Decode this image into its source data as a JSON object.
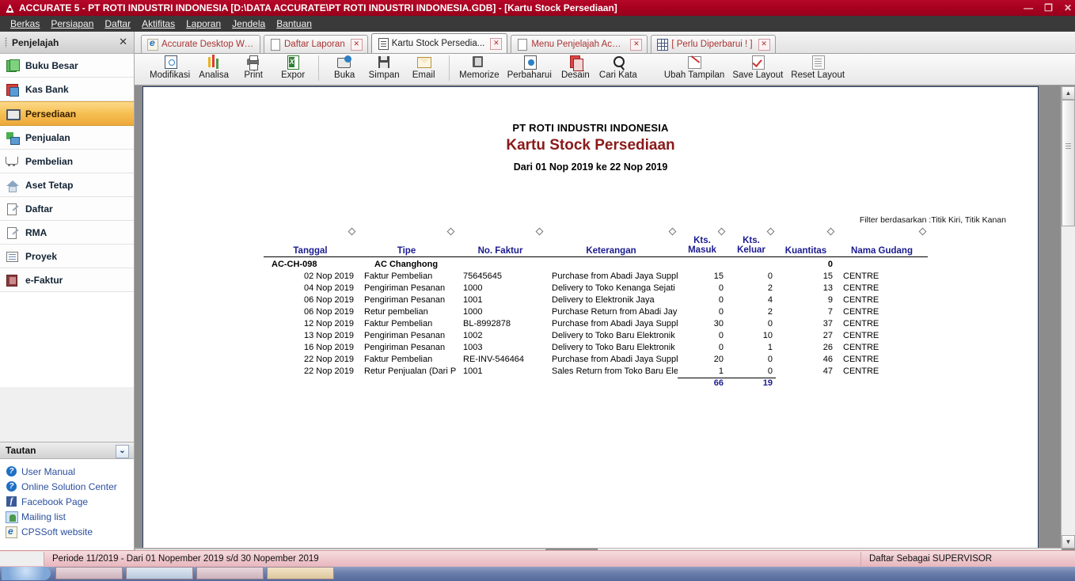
{
  "window": {
    "title": "ACCURATE 5  - PT ROTI INDUSTRI INDONESIA   [D:\\DATA ACCURATE\\PT ROTI INDUSTRI INDONESIA.GDB] - [Kartu Stock Persediaan]",
    "minimize": "—",
    "maximize": "❐",
    "close": "✕",
    "logo": "A"
  },
  "menu": {
    "items": [
      "Berkas",
      "Persiapan",
      "Daftar",
      "Aktifitas",
      "Laporan",
      "Jendela",
      "Bantuan"
    ]
  },
  "sidebar": {
    "header": "Penjelajah",
    "close": "✕",
    "items": [
      {
        "label": "Buku Besar",
        "icon": "ledger-icon"
      },
      {
        "label": "Kas Bank",
        "icon": "bank-icon"
      },
      {
        "label": "Persediaan",
        "icon": "inventory-icon"
      },
      {
        "label": "Penjualan",
        "icon": "sales-icon"
      },
      {
        "label": "Pembelian",
        "icon": "purchase-cart-icon"
      },
      {
        "label": "Aset Tetap",
        "icon": "fixed-asset-icon"
      },
      {
        "label": "Daftar",
        "icon": "list-icon"
      },
      {
        "label": "RMA",
        "icon": "rma-icon"
      },
      {
        "label": "Proyek",
        "icon": "project-icon"
      },
      {
        "label": "e-Faktur",
        "icon": "efaktur-icon"
      }
    ],
    "selected": "Persediaan",
    "links_header": "Tautan",
    "links_chevron": "⌄",
    "links": [
      {
        "label": "User Manual",
        "icon": "help-icon"
      },
      {
        "label": "Online Solution Center",
        "icon": "help-icon"
      },
      {
        "label": "Facebook Page",
        "icon": "facebook-icon"
      },
      {
        "label": "Mailing list",
        "icon": "mail-list-icon"
      },
      {
        "label": "CPSSoft website",
        "icon": "browser-icon"
      }
    ]
  },
  "tabs": [
    {
      "label": "Accurate Desktop Wel...",
      "icon": "browser-icon",
      "active": false,
      "closable": false
    },
    {
      "label": "Daftar Laporan",
      "icon": "document-icon",
      "active": false,
      "closable": true,
      "close": "✕"
    },
    {
      "label": "Kartu Stock Persedia...",
      "icon": "report-icon",
      "active": true,
      "closable": true,
      "close": "✕"
    },
    {
      "label": "Menu Penjelajah Accu...",
      "icon": "document-icon",
      "active": false,
      "closable": true,
      "close": "✕"
    },
    {
      "label": "[ Perlu Diperbarui ! ]",
      "icon": "table-icon",
      "active": false,
      "closable": true,
      "close": "✕"
    }
  ],
  "toolbar": {
    "groups": [
      [
        {
          "label": "Modifikasi",
          "icon": "modify-icon"
        },
        {
          "label": "Analisa",
          "icon": "chart-icon"
        },
        {
          "label": "Print",
          "icon": "printer-icon"
        },
        {
          "label": "Expor",
          "icon": "excel-export-icon"
        }
      ],
      [
        {
          "label": "Buka",
          "icon": "open-folder-icon"
        },
        {
          "label": "Simpan",
          "icon": "save-disk-icon"
        },
        {
          "label": "Email",
          "icon": "envelope-icon"
        }
      ],
      [
        {
          "label": "Memorize",
          "icon": "memorize-icon"
        },
        {
          "label": "Perbaharui",
          "icon": "refresh-icon"
        },
        {
          "label": "Desain",
          "icon": "design-icon"
        },
        {
          "label": "Cari Kata",
          "icon": "search-icon"
        }
      ],
      [
        {
          "label": "Ubah Tampilan",
          "icon": "edit-view-icon"
        },
        {
          "label": "Save Layout",
          "icon": "save-layout-icon"
        },
        {
          "label": "Reset Layout",
          "icon": "reset-layout-icon"
        }
      ]
    ]
  },
  "report": {
    "company": "PT ROTI INDUSTRI INDONESIA",
    "title": "Kartu Stock Persediaan",
    "date_range": "Dari 01 Nop 2019 ke 22 Nop 2019",
    "filter_note": "Filter berdasarkan :Titik Kiri, Titik Kanan",
    "columns": [
      {
        "label": "Tanggal",
        "line2": ""
      },
      {
        "label": "Tipe",
        "line2": ""
      },
      {
        "label": "No. Faktur",
        "line2": ""
      },
      {
        "label": "Keterangan",
        "line2": ""
      },
      {
        "label": "Kts.",
        "line2": "Masuk"
      },
      {
        "label": "Kts.",
        "line2": "Keluar"
      },
      {
        "label": "Kuantitas",
        "line2": ""
      },
      {
        "label": "Nama Gudang",
        "line2": ""
      }
    ],
    "group": {
      "code": "AC-CH-098",
      "name": "AC Changhong",
      "opening_qty": "0"
    },
    "rows": [
      {
        "tanggal": "02 Nop 2019",
        "tipe": "Faktur Pembelian",
        "faktur": "75645645",
        "keterangan": "Purchase from Abadi Jaya Supplier",
        "masuk": "15",
        "keluar": "0",
        "kuantitas": "15",
        "gudang": "CENTRE"
      },
      {
        "tanggal": "04 Nop 2019",
        "tipe": "Pengiriman Pesanan",
        "faktur": "1000",
        "keterangan": "Delivery to Toko Kenanga Sejati",
        "masuk": "0",
        "keluar": "2",
        "kuantitas": "13",
        "gudang": "CENTRE"
      },
      {
        "tanggal": "06 Nop 2019",
        "tipe": "Pengiriman Pesanan",
        "faktur": "1001",
        "keterangan": "Delivery to Elektronik Jaya",
        "masuk": "0",
        "keluar": "4",
        "kuantitas": "9",
        "gudang": "CENTRE"
      },
      {
        "tanggal": "06 Nop 2019",
        "tipe": "Retur pembelian",
        "faktur": "1000",
        "keterangan": "Purchase Return from Abadi Jaya",
        "masuk": "0",
        "keluar": "2",
        "kuantitas": "7",
        "gudang": "CENTRE"
      },
      {
        "tanggal": "12 Nop 2019",
        "tipe": "Faktur Pembelian",
        "faktur": "BL-8992878",
        "keterangan": "Purchase from Abadi Jaya Supplier",
        "masuk": "30",
        "keluar": "0",
        "kuantitas": "37",
        "gudang": "CENTRE"
      },
      {
        "tanggal": "13 Nop 2019",
        "tipe": "Pengiriman Pesanan",
        "faktur": "1002",
        "keterangan": "Delivery to Toko Baru Elektronik",
        "masuk": "0",
        "keluar": "10",
        "kuantitas": "27",
        "gudang": "CENTRE"
      },
      {
        "tanggal": "16 Nop 2019",
        "tipe": "Pengiriman Pesanan",
        "faktur": "1003",
        "keterangan": "Delivery to Toko Baru Elektronik",
        "masuk": "0",
        "keluar": "1",
        "kuantitas": "26",
        "gudang": "CENTRE"
      },
      {
        "tanggal": "22 Nop 2019",
        "tipe": "Faktur Pembelian",
        "faktur": "RE-INV-546464",
        "keterangan": "Purchase from Abadi Jaya Supplier",
        "masuk": "20",
        "keluar": "0",
        "kuantitas": "46",
        "gudang": "CENTRE"
      },
      {
        "tanggal": "22 Nop 2019",
        "tipe": "Retur Penjualan (Dari Pesanan)",
        "faktur": "1001",
        "keterangan": "Sales Return from Toko Baru Elektronik",
        "masuk": "1",
        "keluar": "0",
        "kuantitas": "47",
        "gudang": "CENTRE"
      }
    ],
    "totals": {
      "masuk": "66",
      "keluar": "19"
    }
  },
  "statusbar": {
    "period": "Periode 11/2019 - Dari 01 Nopember 2019 s/d 30 Nopember 2019",
    "user": "Daftar Sebagai SUPERVISOR"
  },
  "scroll": {
    "up_arrow": "▲",
    "down_arrow": "▼"
  }
}
